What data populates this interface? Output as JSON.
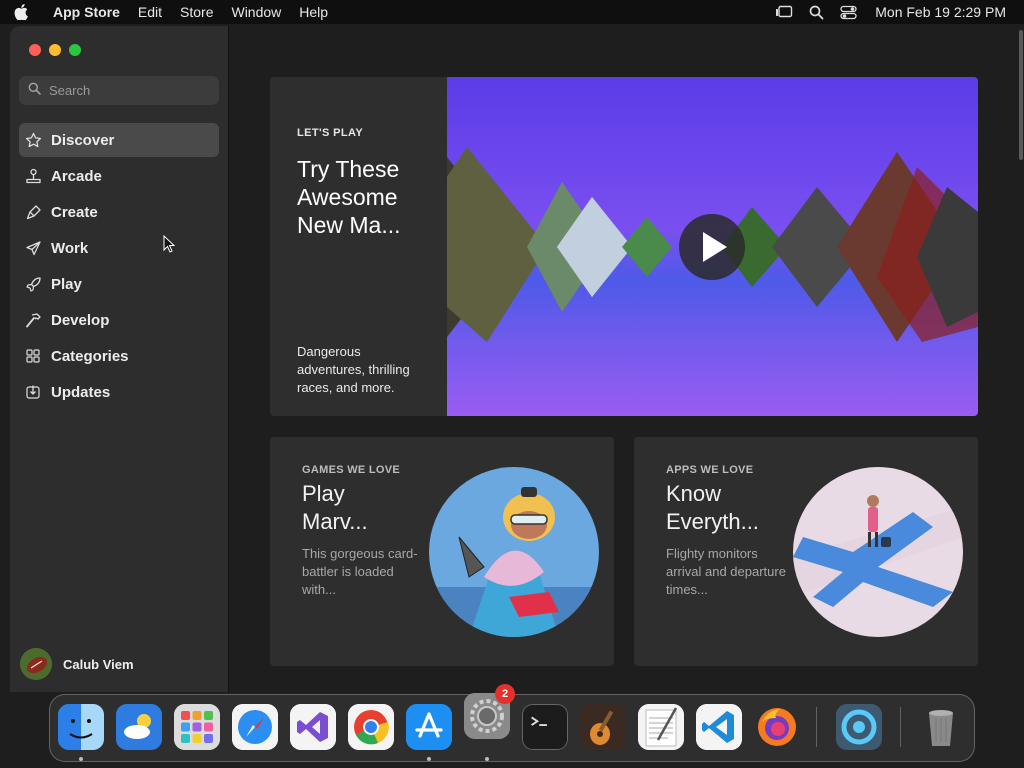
{
  "menubar": {
    "app_name": "App Store",
    "menus": [
      "Edit",
      "Store",
      "Window",
      "Help"
    ],
    "clock": "Mon Feb 19  2:29 PM"
  },
  "sidebar": {
    "search_placeholder": "Search",
    "items": [
      {
        "label": "Discover",
        "icon": "star-icon",
        "active": true
      },
      {
        "label": "Arcade",
        "icon": "joystick-icon"
      },
      {
        "label": "Create",
        "icon": "brush-icon"
      },
      {
        "label": "Work",
        "icon": "paper-plane-icon"
      },
      {
        "label": "Play",
        "icon": "rocket-icon"
      },
      {
        "label": "Develop",
        "icon": "hammer-icon"
      },
      {
        "label": "Categories",
        "icon": "grid-icon"
      },
      {
        "label": "Updates",
        "icon": "download-icon"
      }
    ],
    "user_name": "Calub Viem"
  },
  "hero": {
    "eyebrow": "LET'S PLAY",
    "title": "Try These Awesome New Ma...",
    "description": "Dangerous adventures, thrilling races, and more."
  },
  "cards": [
    {
      "eyebrow": "GAMES WE LOVE",
      "title": "Play Marv...",
      "description": "This gorgeous card-battler is loaded with..."
    },
    {
      "eyebrow": "APPS WE LOVE",
      "title": "Know Everyth...",
      "description": "Flighty monitors arrival and departure times..."
    }
  ],
  "dock": {
    "apps": [
      "finder-icon",
      "weather-icon",
      "launchpad-icon",
      "safari-icon",
      "visual-studio-icon",
      "chrome-icon",
      "app-store-icon",
      "system-settings-icon",
      "terminal-icon",
      "garageband-icon",
      "textedit-icon",
      "vscode-icon",
      "firefox-icon",
      "proxyman-icon",
      "trash-icon"
    ],
    "settings_badge": "2"
  },
  "colors": {
    "close": "#ff5f57",
    "minimize": "#febc2e",
    "zoom": "#28c840",
    "hero_purple": "#6a3cf0",
    "badge_red": "#e5312c"
  }
}
